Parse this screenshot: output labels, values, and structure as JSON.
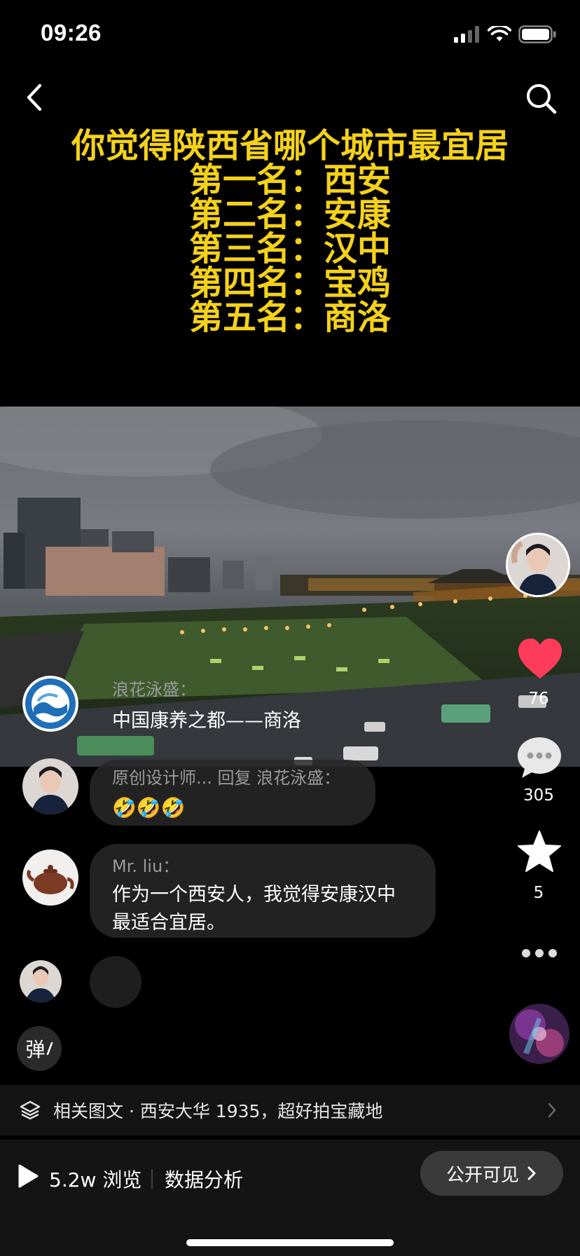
{
  "status_bar": {
    "time": "09:26"
  },
  "headline": {
    "lines": [
      "你觉得陕西省哪个城市最宜居",
      "第一名：西安",
      "第二名：安康",
      "第三名：汉中",
      "第四名：宝鸡",
      "第五名：商洛"
    ],
    "color": "#f5d21a"
  },
  "rail": {
    "likes": "76",
    "comments": "305",
    "favorites": "5",
    "like_color": "#ff3b5c"
  },
  "comments": [
    {
      "name": "浪花泳盛：",
      "text": "中国康养之都——商洛"
    },
    {
      "name": "原创设计师... 回复 浪花泳盛：",
      "text": "🤣🤣🤣"
    },
    {
      "name": "Mr. liu：",
      "text": "作为一个西安人，我觉得安康汉中最适合宜居。"
    }
  ],
  "danmaku_label": "弹",
  "related": {
    "text": "相关图文 · 西安大华 1935，超好拍宝藏地"
  },
  "bottom": {
    "views": "5.2w 浏览",
    "analysis": "数据分析",
    "visibility": "公开可见"
  }
}
